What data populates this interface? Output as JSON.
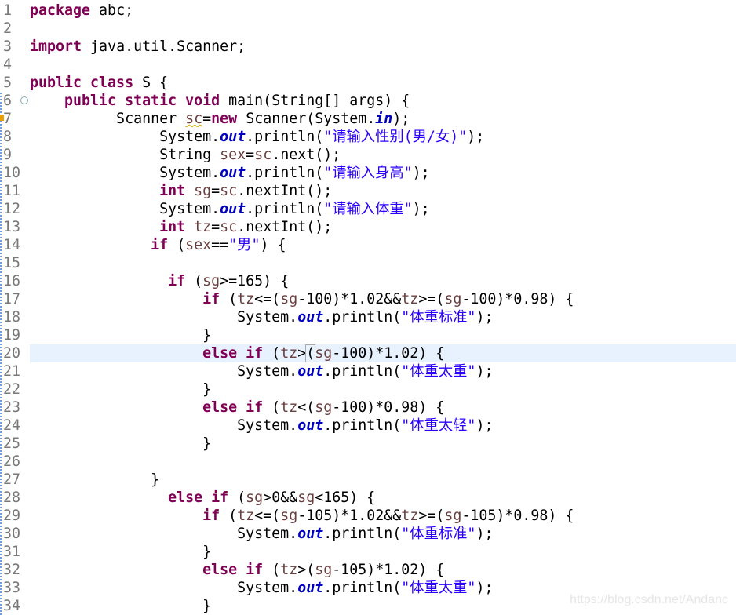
{
  "editor": {
    "highlighted_line": 20,
    "colors": {
      "keyword": "#7F0055",
      "local_variable": "#6A3E3E",
      "static_field": "#0000C0",
      "string": "#2A00FF",
      "current_line": "#E8F2FE"
    },
    "lines": [
      [
        [
          "k",
          "package"
        ],
        [
          "p",
          " abc;"
        ]
      ],
      [],
      [
        [
          "k",
          "import"
        ],
        [
          "p",
          " java.util.Scanner;"
        ]
      ],
      [],
      [
        [
          "k",
          "public class"
        ],
        [
          "p",
          " S {"
        ]
      ],
      [
        [
          "p",
          "    "
        ],
        [
          "k",
          "public static void"
        ],
        [
          "p",
          " main(String[] args) {"
        ]
      ],
      [
        [
          "p",
          "          Scanner "
        ],
        [
          "vw",
          "sc"
        ],
        [
          "p",
          "="
        ],
        [
          "k",
          "new"
        ],
        [
          "p",
          " Scanner(System."
        ],
        [
          "f",
          "in"
        ],
        [
          "p",
          ");"
        ]
      ],
      [
        [
          "p",
          "               System."
        ],
        [
          "f",
          "out"
        ],
        [
          "p",
          ".println("
        ],
        [
          "s",
          "\"请输入性别(男/女)\""
        ],
        [
          "p",
          ");"
        ]
      ],
      [
        [
          "p",
          "               String "
        ],
        [
          "v",
          "sex"
        ],
        [
          "p",
          "="
        ],
        [
          "v",
          "sc"
        ],
        [
          "p",
          ".next();"
        ]
      ],
      [
        [
          "p",
          "               System."
        ],
        [
          "f",
          "out"
        ],
        [
          "p",
          ".println("
        ],
        [
          "s",
          "\"请输入身高\""
        ],
        [
          "p",
          ");"
        ]
      ],
      [
        [
          "p",
          "               "
        ],
        [
          "k",
          "int"
        ],
        [
          "p",
          " "
        ],
        [
          "v",
          "sg"
        ],
        [
          "p",
          "="
        ],
        [
          "v",
          "sc"
        ],
        [
          "p",
          ".nextInt();"
        ]
      ],
      [
        [
          "p",
          "               System."
        ],
        [
          "f",
          "out"
        ],
        [
          "p",
          ".println("
        ],
        [
          "s",
          "\"请输入体重\""
        ],
        [
          "p",
          ");"
        ]
      ],
      [
        [
          "p",
          "               "
        ],
        [
          "k",
          "int"
        ],
        [
          "p",
          " "
        ],
        [
          "v",
          "tz"
        ],
        [
          "p",
          "="
        ],
        [
          "v",
          "sc"
        ],
        [
          "p",
          ".nextInt();"
        ]
      ],
      [
        [
          "p",
          "              "
        ],
        [
          "k",
          "if"
        ],
        [
          "p",
          " ("
        ],
        [
          "v",
          "sex"
        ],
        [
          "p",
          "=="
        ],
        [
          "s",
          "\"男\""
        ],
        [
          "p",
          ") {"
        ]
      ],
      [],
      [
        [
          "p",
          "                "
        ],
        [
          "k",
          "if"
        ],
        [
          "p",
          " ("
        ],
        [
          "v",
          "sg"
        ],
        [
          "p",
          ">=165) {"
        ]
      ],
      [
        [
          "p",
          "                    "
        ],
        [
          "k",
          "if"
        ],
        [
          "p",
          " ("
        ],
        [
          "v",
          "tz"
        ],
        [
          "p",
          "<=("
        ],
        [
          "v",
          "sg"
        ],
        [
          "p",
          "-100)*1.02&&"
        ],
        [
          "v",
          "tz"
        ],
        [
          "p",
          ">=("
        ],
        [
          "v",
          "sg"
        ],
        [
          "p",
          "-100)*0.98) {"
        ]
      ],
      [
        [
          "p",
          "                        System."
        ],
        [
          "f",
          "out"
        ],
        [
          "p",
          ".println("
        ],
        [
          "s",
          "\"体重标准\""
        ],
        [
          "p",
          ");"
        ]
      ],
      [
        [
          "p",
          "                    }"
        ]
      ],
      [
        [
          "p",
          "                    "
        ],
        [
          "k",
          "else if"
        ],
        [
          "p",
          " ("
        ],
        [
          "v",
          "tz"
        ],
        [
          "p",
          ">"
        ],
        [
          "b",
          "("
        ],
        [
          "v",
          "sg"
        ],
        [
          "p",
          "-100)*1.02) {"
        ]
      ],
      [
        [
          "p",
          "                        System."
        ],
        [
          "f",
          "out"
        ],
        [
          "p",
          ".println("
        ],
        [
          "s",
          "\"体重太重\""
        ],
        [
          "p",
          ");"
        ]
      ],
      [
        [
          "p",
          "                    }"
        ]
      ],
      [
        [
          "p",
          "                    "
        ],
        [
          "k",
          "else if"
        ],
        [
          "p",
          " ("
        ],
        [
          "v",
          "tz"
        ],
        [
          "p",
          "<("
        ],
        [
          "v",
          "sg"
        ],
        [
          "p",
          "-100)*0.98) {"
        ]
      ],
      [
        [
          "p",
          "                        System."
        ],
        [
          "f",
          "out"
        ],
        [
          "p",
          ".println("
        ],
        [
          "s",
          "\"体重太轻\""
        ],
        [
          "p",
          ");"
        ]
      ],
      [
        [
          "p",
          "                    }"
        ]
      ],
      [],
      [
        [
          "p",
          "              }"
        ]
      ],
      [
        [
          "p",
          "                "
        ],
        [
          "k",
          "else if"
        ],
        [
          "p",
          " ("
        ],
        [
          "v",
          "sg"
        ],
        [
          "p",
          ">0&&"
        ],
        [
          "v",
          "sg"
        ],
        [
          "p",
          "<165) {"
        ]
      ],
      [
        [
          "p",
          "                    "
        ],
        [
          "k",
          "if"
        ],
        [
          "p",
          " ("
        ],
        [
          "v",
          "tz"
        ],
        [
          "p",
          "<=("
        ],
        [
          "v",
          "sg"
        ],
        [
          "p",
          "-105)*1.02&&"
        ],
        [
          "v",
          "tz"
        ],
        [
          "p",
          ">=("
        ],
        [
          "v",
          "sg"
        ],
        [
          "p",
          "-105)*0.98) {"
        ]
      ],
      [
        [
          "p",
          "                        System."
        ],
        [
          "f",
          "out"
        ],
        [
          "p",
          ".println("
        ],
        [
          "s",
          "\"体重标准\""
        ],
        [
          "p",
          ");"
        ]
      ],
      [
        [
          "p",
          "                    }"
        ]
      ],
      [
        [
          "p",
          "                    "
        ],
        [
          "k",
          "else if"
        ],
        [
          "p",
          " ("
        ],
        [
          "v",
          "tz"
        ],
        [
          "p",
          ">("
        ],
        [
          "v",
          "sg"
        ],
        [
          "p",
          "-105)*1.02) {"
        ]
      ],
      [
        [
          "p",
          "                        System."
        ],
        [
          "f",
          "out"
        ],
        [
          "p",
          ".println("
        ],
        [
          "s",
          "\"体重太重\""
        ],
        [
          "p",
          ");"
        ]
      ],
      [
        [
          "p",
          "                    }"
        ]
      ]
    ]
  },
  "watermark": "https://blog.csdn.net/Andanc"
}
